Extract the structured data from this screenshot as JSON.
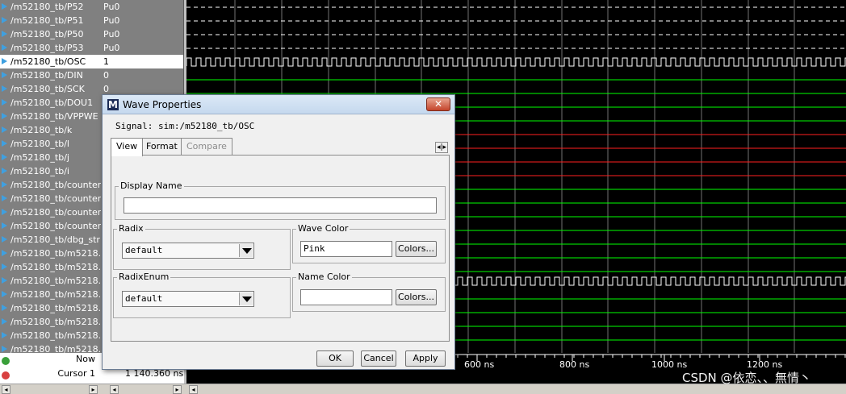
{
  "signals": [
    {
      "name": "/m52180_tb/P52",
      "value": "Pu0"
    },
    {
      "name": "/m52180_tb/P51",
      "value": "Pu0"
    },
    {
      "name": "/m52180_tb/P50",
      "value": "Pu0"
    },
    {
      "name": "/m52180_tb/P53",
      "value": "Pu0"
    },
    {
      "name": "/m52180_tb/OSC",
      "value": "1",
      "selected": true
    },
    {
      "name": "/m52180_tb/DIN",
      "value": "0"
    },
    {
      "name": "/m52180_tb/SCK",
      "value": "0"
    },
    {
      "name": "/m52180_tb/DOU1",
      "value": ""
    },
    {
      "name": "/m52180_tb/VPPWE",
      "value": ""
    },
    {
      "name": "/m52180_tb/k",
      "value": ""
    },
    {
      "name": "/m52180_tb/l",
      "value": ""
    },
    {
      "name": "/m52180_tb/j",
      "value": ""
    },
    {
      "name": "/m52180_tb/i",
      "value": ""
    },
    {
      "name": "/m52180_tb/counter1",
      "value": ""
    },
    {
      "name": "/m52180_tb/counter2",
      "value": ""
    },
    {
      "name": "/m52180_tb/counter5",
      "value": ""
    },
    {
      "name": "/m52180_tb/counter3",
      "value": ""
    },
    {
      "name": "/m52180_tb/dbg_str",
      "value": ""
    },
    {
      "name": "/m52180_tb/m5218...",
      "value": ""
    },
    {
      "name": "/m52180_tb/m5218...",
      "value": ""
    },
    {
      "name": "/m52180_tb/m5218...",
      "value": ""
    },
    {
      "name": "/m52180_tb/m5218...",
      "value": ""
    },
    {
      "name": "/m52180_tb/m5218...",
      "value": ""
    },
    {
      "name": "/m52180_tb/m5218...",
      "value": ""
    },
    {
      "name": "/m52180_tb/m5218...",
      "value": ""
    },
    {
      "name": "/m52180_tb/m5218...",
      "value": ""
    }
  ],
  "footer": {
    "now_label": "Now",
    "cursor_label": "Cursor 1",
    "cursor_value": "1 140.360 ns"
  },
  "time_ruler": {
    "ticks": [
      "600 ns",
      "800 ns",
      "1000 ns",
      "1200 ns"
    ]
  },
  "watermark": "CSDN @依恋、、無情丶",
  "dialog": {
    "title": "Wave Properties",
    "close_label": "✕",
    "signal_text": "Signal: sim:/m52180_tb/OSC",
    "tabs": [
      {
        "label": "View",
        "state": "active"
      },
      {
        "label": "Format",
        "state": "normal"
      },
      {
        "label": "Compare",
        "state": "disabled"
      }
    ],
    "tab_scroll": "◂|▸",
    "display_name": {
      "legend": "Display Name",
      "value": ""
    },
    "radix": {
      "legend": "Radix",
      "value": "default"
    },
    "radix_enum": {
      "legend": "RadixEnum",
      "value": "default"
    },
    "wave_color": {
      "legend": "Wave Color",
      "value": "Pink",
      "button": "Colors..."
    },
    "name_color": {
      "legend": "Name Color",
      "value": "",
      "button": "Colors..."
    },
    "ok_label": "OK",
    "cancel_label": "Cancel",
    "apply_label": "Apply"
  },
  "colors": {
    "wave_green": "#00ff00",
    "wave_red": "#ff2020",
    "grid": "#ffffff",
    "selected_row": "#ffffff",
    "name_pane": "#808080"
  }
}
